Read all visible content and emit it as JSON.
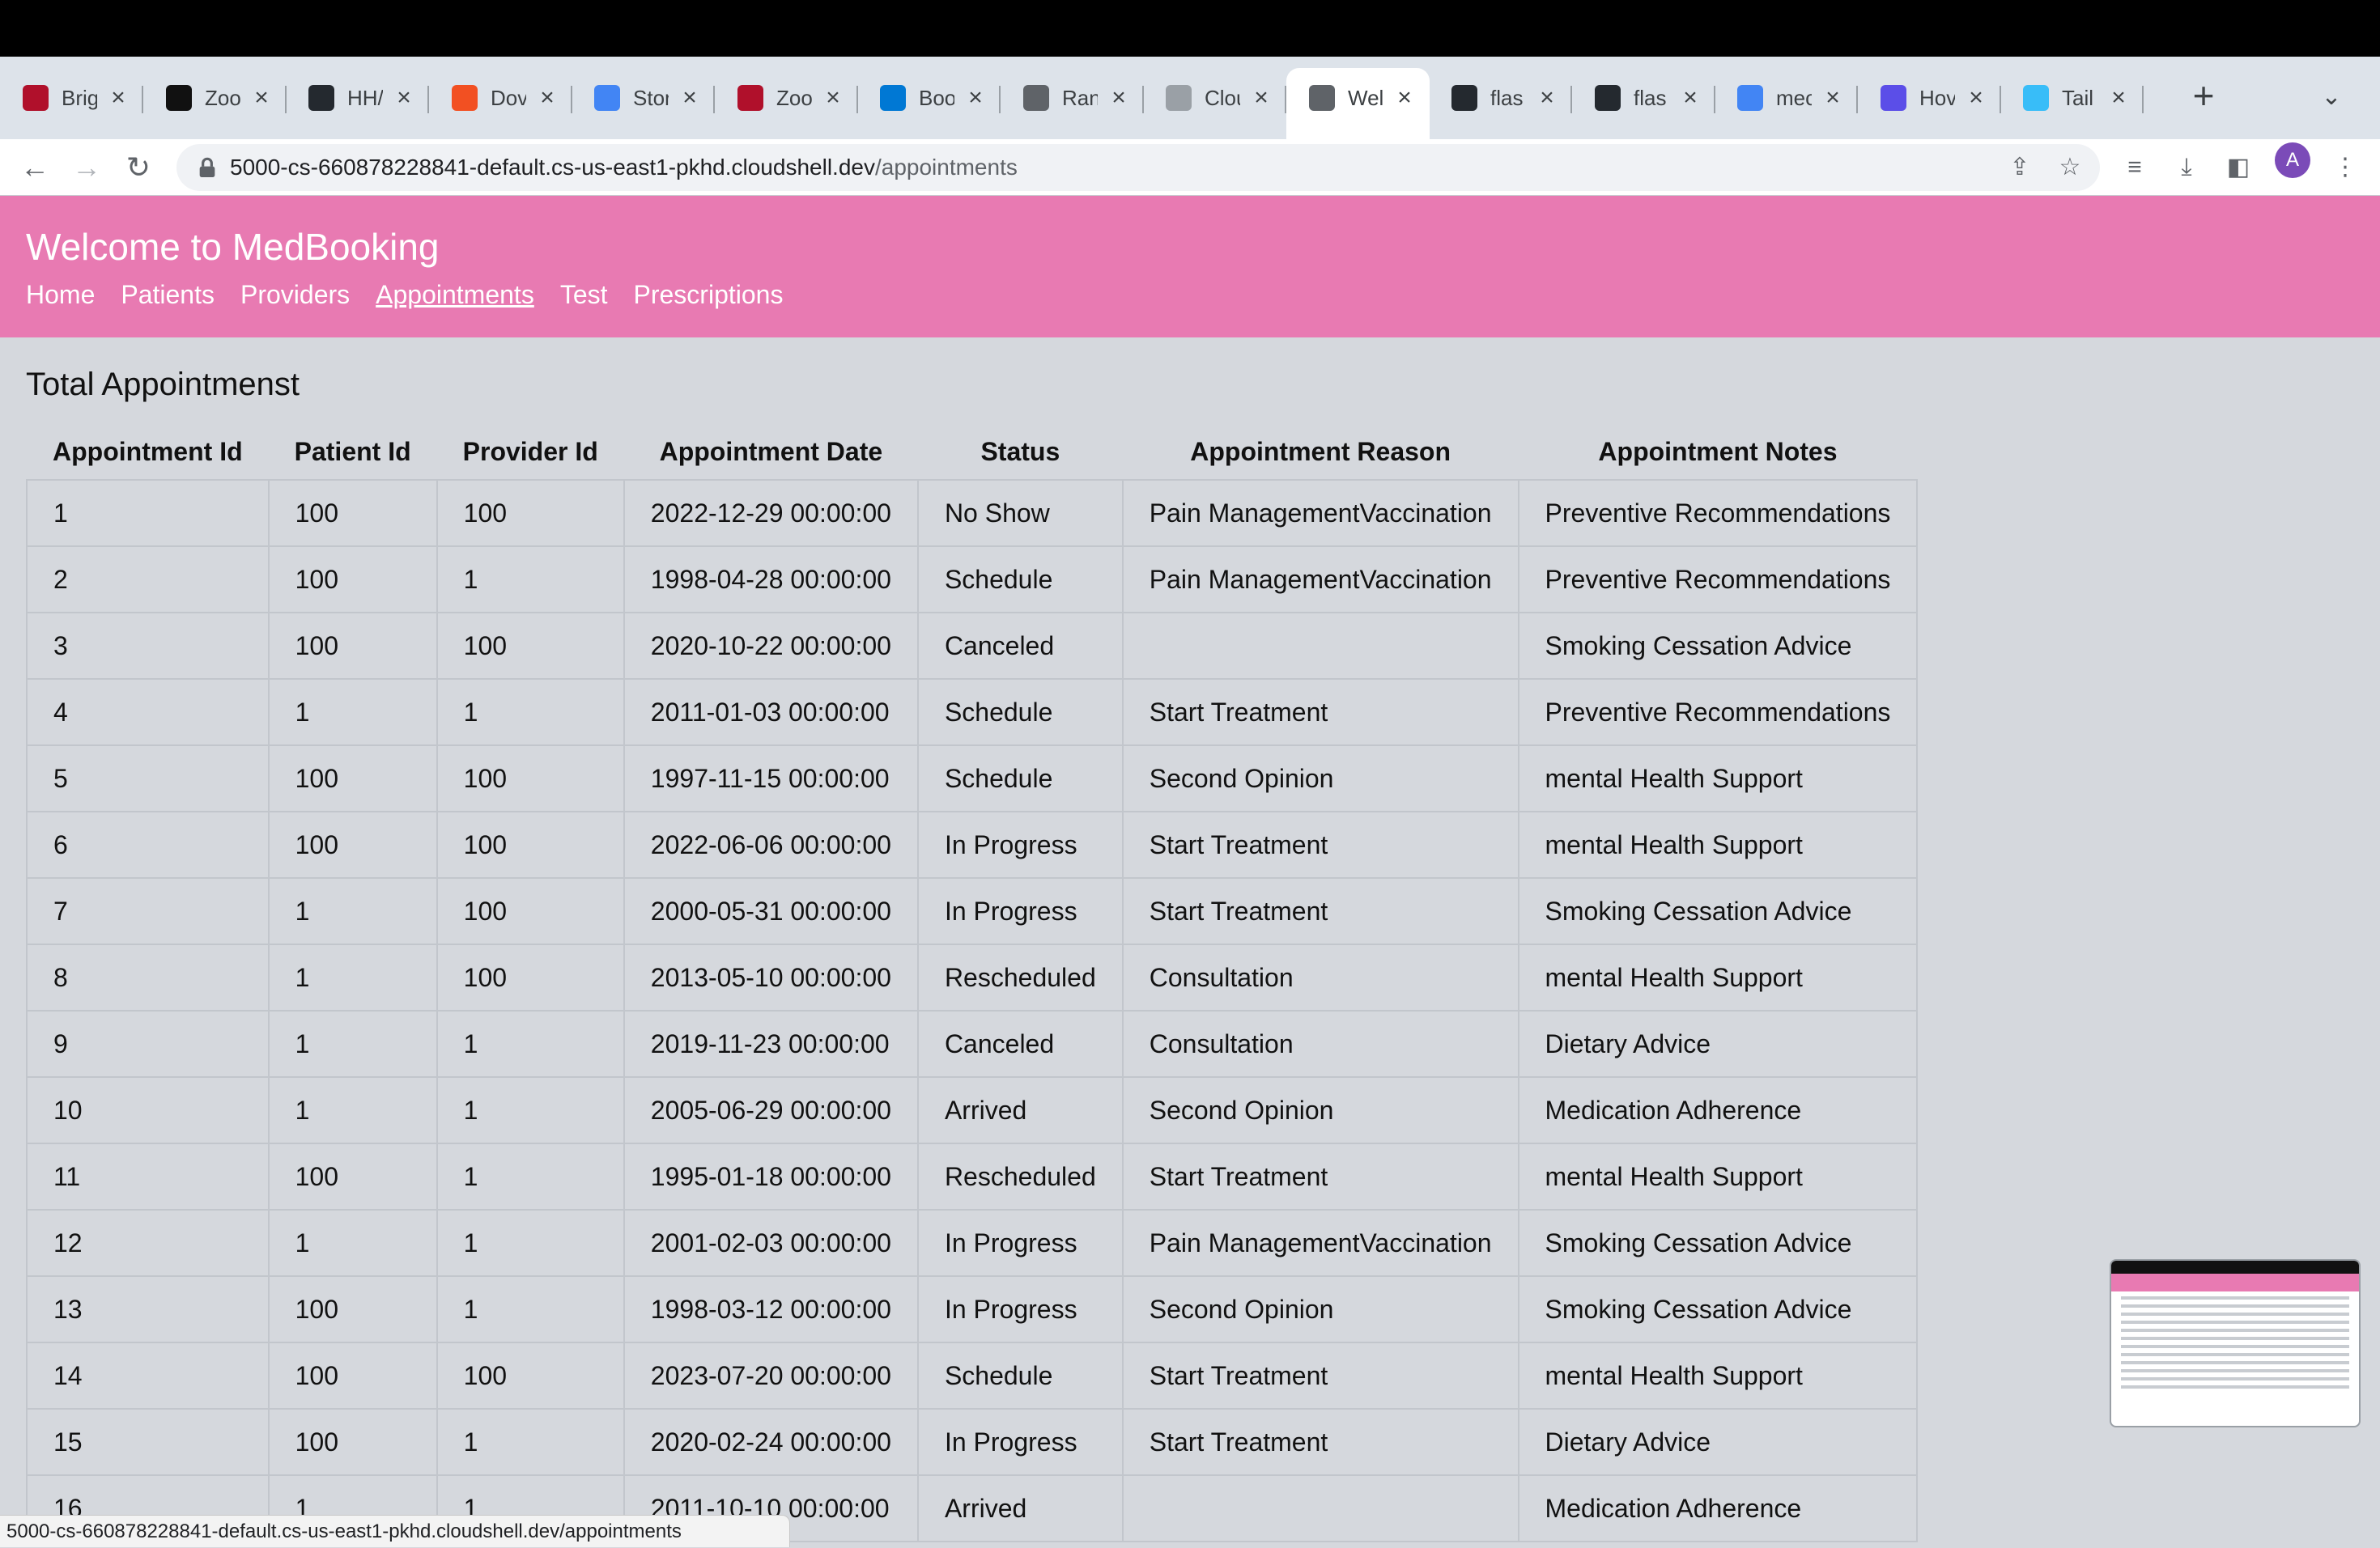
{
  "browser": {
    "tabs": [
      {
        "title": "Brig",
        "icon": "shield",
        "color": "#b0102b"
      },
      {
        "title": "Zoo",
        "icon": "d2l",
        "color": "#111111"
      },
      {
        "title": "HH/",
        "icon": "github",
        "color": "#24292f"
      },
      {
        "title": "Dov",
        "icon": "microsoft",
        "color": "#f25022"
      },
      {
        "title": "Stor",
        "icon": "calendar",
        "color": "#4285f4"
      },
      {
        "title": "Zoo",
        "icon": "shield",
        "color": "#b0102b"
      },
      {
        "title": "Boo",
        "icon": "azure",
        "color": "#0078d4"
      },
      {
        "title": "Ran",
        "icon": "mascot",
        "color": "#5f6368"
      },
      {
        "title": "Clou",
        "icon": "cloud-shell",
        "color": "#9aa0a6"
      },
      {
        "title": "Wel",
        "icon": "globe",
        "color": "#5f6368",
        "active": true
      },
      {
        "title": "flas",
        "icon": "github",
        "color": "#24292f"
      },
      {
        "title": "flas",
        "icon": "github",
        "color": "#24292f"
      },
      {
        "title": "mec",
        "icon": "google",
        "color": "#4285f4"
      },
      {
        "title": "Hov",
        "icon": "bookmark",
        "color": "#5b4ee8"
      },
      {
        "title": "Tail",
        "icon": "tailwind",
        "color": "#38bdf8"
      }
    ],
    "url_host": "5000-cs-660878228841-default.cs-us-east1-pkhd.cloudshell.dev",
    "url_path": "/appointments",
    "avatar_letter": "A",
    "status_text": "5000-cs-660878228841-default.cs-us-east1-pkhd.cloudshell.dev/appointments"
  },
  "site": {
    "title": "Welcome to MedBooking",
    "nav": [
      "Home",
      "Patients",
      "Providers",
      "Appointments",
      "Test",
      "Prescriptions"
    ],
    "current": "Appointments"
  },
  "page": {
    "heading": "Total Appointmenst",
    "columns": [
      "Appointment Id",
      "Patient Id",
      "Provider Id",
      "Appointment Date",
      "Status",
      "Appointment Reason",
      "Appointment Notes"
    ],
    "rows": [
      [
        "1",
        "100",
        "100",
        "2022-12-29 00:00:00",
        "No Show",
        "Pain ManagementVaccination",
        "Preventive Recommendations"
      ],
      [
        "2",
        "100",
        "1",
        "1998-04-28 00:00:00",
        "Schedule",
        "Pain ManagementVaccination",
        "Preventive Recommendations"
      ],
      [
        "3",
        "100",
        "100",
        "2020-10-22 00:00:00",
        "Canceled",
        "",
        "Smoking Cessation Advice"
      ],
      [
        "4",
        "1",
        "1",
        "2011-01-03 00:00:00",
        "Schedule",
        "Start Treatment",
        "Preventive Recommendations"
      ],
      [
        "5",
        "100",
        "100",
        "1997-11-15 00:00:00",
        "Schedule",
        "Second Opinion",
        "mental Health Support"
      ],
      [
        "6",
        "100",
        "100",
        "2022-06-06 00:00:00",
        "In Progress",
        "Start Treatment",
        "mental Health Support"
      ],
      [
        "7",
        "1",
        "100",
        "2000-05-31 00:00:00",
        "In Progress",
        "Start Treatment",
        "Smoking Cessation Advice"
      ],
      [
        "8",
        "1",
        "100",
        "2013-05-10 00:00:00",
        "Rescheduled",
        "Consultation",
        "mental Health Support"
      ],
      [
        "9",
        "1",
        "1",
        "2019-11-23 00:00:00",
        "Canceled",
        "Consultation",
        "Dietary Advice"
      ],
      [
        "10",
        "1",
        "1",
        "2005-06-29 00:00:00",
        "Arrived",
        "Second Opinion",
        "Medication Adherence"
      ],
      [
        "11",
        "100",
        "1",
        "1995-01-18 00:00:00",
        "Rescheduled",
        "Start Treatment",
        "mental Health Support"
      ],
      [
        "12",
        "1",
        "1",
        "2001-02-03 00:00:00",
        "In Progress",
        "Pain ManagementVaccination",
        "Smoking Cessation Advice"
      ],
      [
        "13",
        "100",
        "1",
        "1998-03-12 00:00:00",
        "In Progress",
        "Second Opinion",
        "Smoking Cessation Advice"
      ],
      [
        "14",
        "100",
        "100",
        "2023-07-20 00:00:00",
        "Schedule",
        "Start Treatment",
        "mental Health Support"
      ],
      [
        "15",
        "100",
        "1",
        "2020-02-24 00:00:00",
        "In Progress",
        "Start Treatment",
        "Dietary Advice"
      ],
      [
        "16",
        "1",
        "1",
        "2011-10-10 00:00:00",
        "Arrived",
        "",
        "Medication Adherence"
      ]
    ]
  }
}
